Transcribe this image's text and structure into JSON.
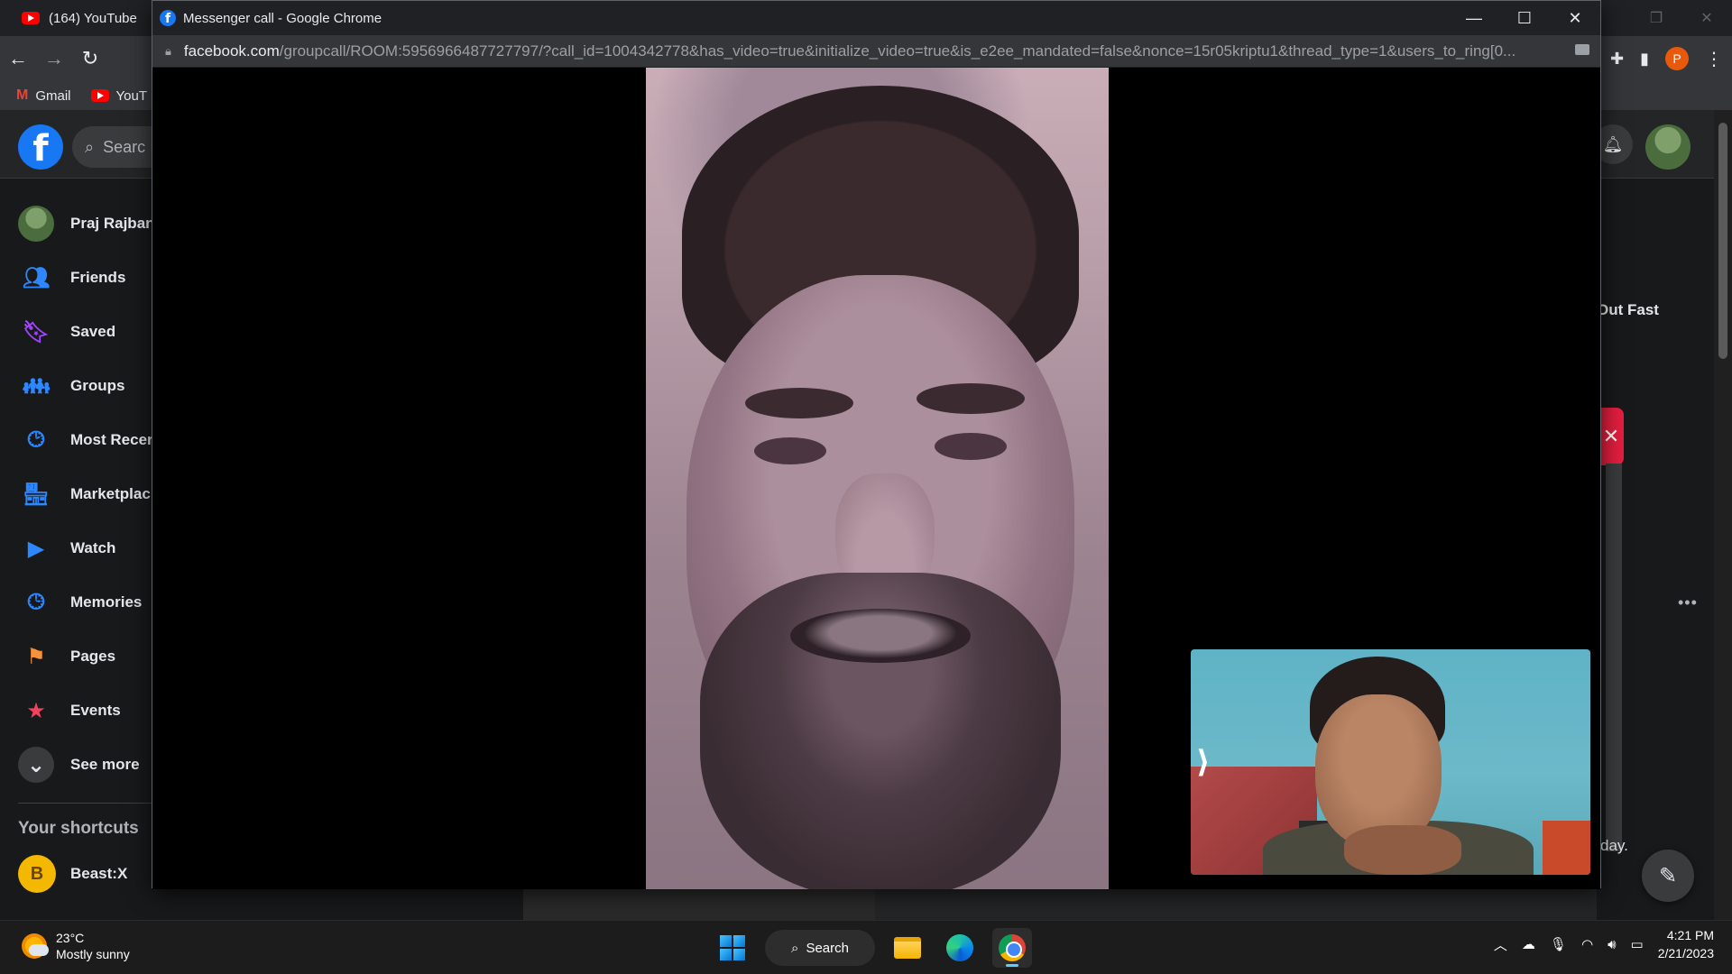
{
  "background_chrome": {
    "tab_title": "(164) YouTube",
    "bookmarks": [
      {
        "label": "Gmail",
        "icon": "gmail-icon"
      },
      {
        "label": "YouT",
        "icon": "youtube-icon"
      }
    ],
    "profile_initial": "P"
  },
  "facebook": {
    "search_placeholder": "Searc",
    "sidebar": [
      {
        "label": "Praj Rajban",
        "icon": "profile-avatar",
        "color": "#4b6d3e"
      },
      {
        "label": "Friends",
        "icon": "friends-icon",
        "color": "#2d88ff"
      },
      {
        "label": "Saved",
        "icon": "bookmark-icon",
        "color": "#a044ff"
      },
      {
        "label": "Groups",
        "icon": "groups-icon",
        "color": "#2d88ff"
      },
      {
        "label": "Most Recer",
        "icon": "feed-icon",
        "color": "#2d88ff"
      },
      {
        "label": "Marketplac",
        "icon": "marketplace-icon",
        "color": "#2d88ff"
      },
      {
        "label": "Watch",
        "icon": "watch-icon",
        "color": "#2d88ff"
      },
      {
        "label": "Memories",
        "icon": "memories-icon",
        "color": "#2d88ff"
      },
      {
        "label": "Pages",
        "icon": "pages-icon",
        "color": "#f7923b"
      },
      {
        "label": "Events",
        "icon": "events-icon",
        "color": "#f3425f"
      },
      {
        "label": "See more",
        "icon": "chevron-down-icon",
        "color": "#3a3b3c"
      }
    ],
    "shortcuts_title": "Your shortcuts",
    "shortcut": {
      "initial": "B",
      "label": "Beast:X"
    },
    "right_fragment_1": "Out Fast",
    "right_fragment_2": "day."
  },
  "call_window": {
    "title": "Messenger call - Google Chrome",
    "url_domain": "facebook.com",
    "url_path": "/groupcall/ROOM:5956966487727797/?call_id=1004342778&has_video=true&initialize_video=true&is_e2ee_mandated=false&nonce=15r05kriptu1&thread_type=1&users_to_ring[0..."
  },
  "taskbar": {
    "weather_temp": "23°C",
    "weather_desc": "Mostly sunny",
    "search_label": "Search",
    "time": "4:21 PM",
    "date": "2/21/2023"
  }
}
